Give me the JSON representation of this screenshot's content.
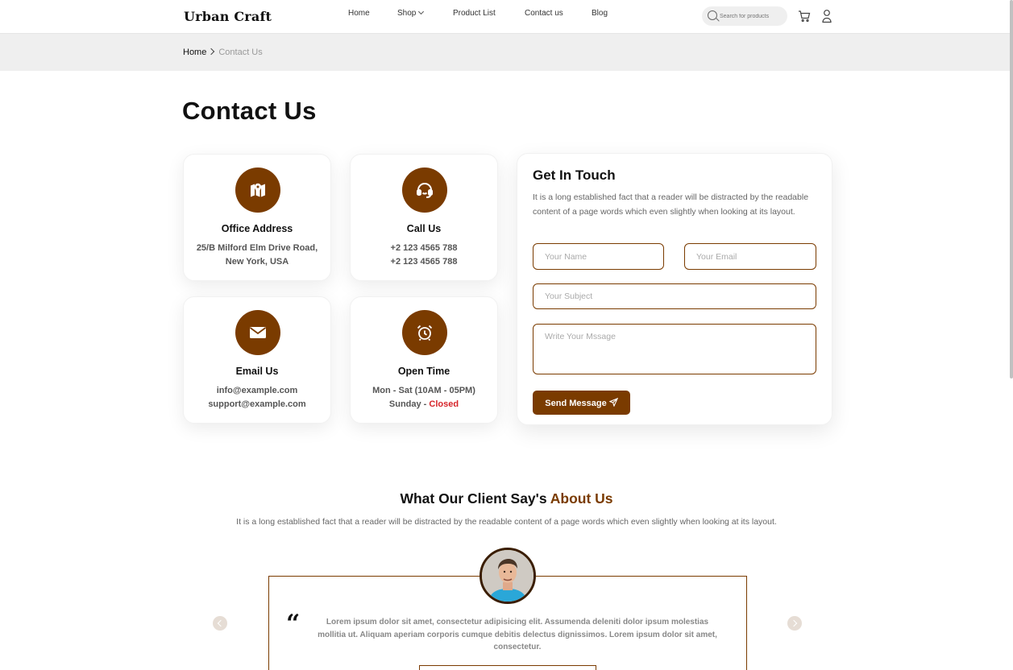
{
  "header": {
    "logo": "Urban Craft",
    "nav": [
      {
        "label": "Home"
      },
      {
        "label": "Shop",
        "has_dropdown": true
      },
      {
        "label": "Product List"
      },
      {
        "label": "Contact us"
      },
      {
        "label": "Blog"
      }
    ],
    "search_placeholder": "Search for products",
    "icons": [
      "search-icon",
      "cart-icon",
      "user-icon"
    ]
  },
  "breadcrumb": {
    "home": "Home",
    "current": "Contact Us"
  },
  "page_title": "Contact Us",
  "info_cards": [
    {
      "icon": "map-icon",
      "title": "Office Address",
      "line1": "25/B Milford Elm Drive Road,",
      "line2": "New York, USA"
    },
    {
      "icon": "headset-icon",
      "title": "Call Us",
      "line1": "+2 123 4565 788",
      "line2": "+2 123 4565 788"
    },
    {
      "icon": "envelope-icon",
      "title": "Email Us",
      "line1": "info@example.com",
      "line2": "support@example.com"
    },
    {
      "icon": "alarm-clock-icon",
      "title": "Open Time",
      "line1": "Mon - Sat (10AM - 05PM)",
      "line2_prefix": "Sunday - ",
      "line2_status": "Closed"
    }
  ],
  "contact_form": {
    "title": "Get In Touch",
    "description": "It is a long established fact that a reader will be distracted by the readable content of a page words which even slightly when looking at its layout.",
    "name_placeholder": "Your Name",
    "email_placeholder": "Your Email",
    "subject_placeholder": "Your Subject",
    "message_placeholder": "Write Your Mssage",
    "send_label": "Send Message"
  },
  "testimonials": {
    "heading_main": "What Our Client Say's ",
    "heading_accent": "About Us",
    "subtitle": "It is a long established fact that a reader will be distracted by the readable content of a page words which even slightly when looking at its layout.",
    "quote_mark": "“",
    "quote": "Lorem ipsum dolor sit amet, consectetur adipisicing elit. Assumenda deleniti dolor ipsum molestias mollitia ut. Aliquam aperiam corporis cumque debitis delectus dignissimos. Lorem ipsum dolor sit amet, consectetur."
  },
  "colors": {
    "accent": "#7a3b00",
    "closed": "#d6242a",
    "band": "#efefef"
  }
}
